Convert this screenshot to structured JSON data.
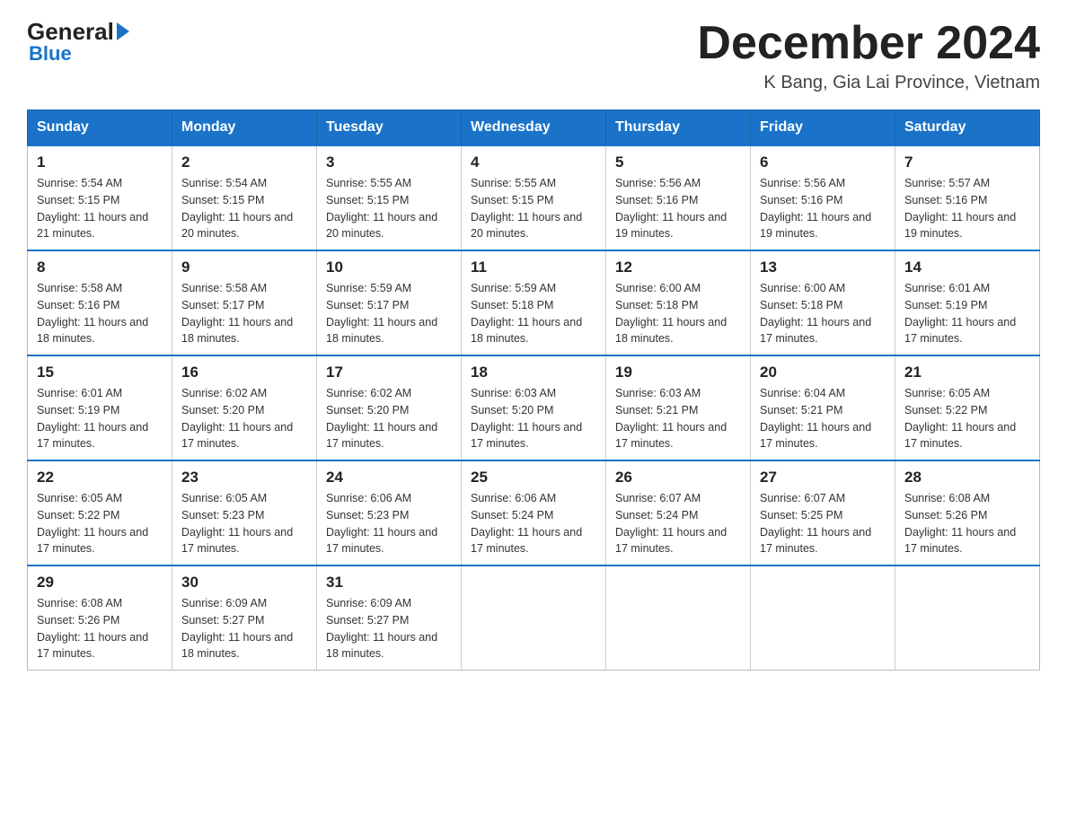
{
  "logo": {
    "text_general": "General",
    "text_blue": "Blue"
  },
  "title": "December 2024",
  "subtitle": "K Bang, Gia Lai Province, Vietnam",
  "days_of_week": [
    "Sunday",
    "Monday",
    "Tuesday",
    "Wednesday",
    "Thursday",
    "Friday",
    "Saturday"
  ],
  "weeks": [
    [
      {
        "day": "1",
        "sunrise": "5:54 AM",
        "sunset": "5:15 PM",
        "daylight": "11 hours and 21 minutes."
      },
      {
        "day": "2",
        "sunrise": "5:54 AM",
        "sunset": "5:15 PM",
        "daylight": "11 hours and 20 minutes."
      },
      {
        "day": "3",
        "sunrise": "5:55 AM",
        "sunset": "5:15 PM",
        "daylight": "11 hours and 20 minutes."
      },
      {
        "day": "4",
        "sunrise": "5:55 AM",
        "sunset": "5:15 PM",
        "daylight": "11 hours and 20 minutes."
      },
      {
        "day": "5",
        "sunrise": "5:56 AM",
        "sunset": "5:16 PM",
        "daylight": "11 hours and 19 minutes."
      },
      {
        "day": "6",
        "sunrise": "5:56 AM",
        "sunset": "5:16 PM",
        "daylight": "11 hours and 19 minutes."
      },
      {
        "day": "7",
        "sunrise": "5:57 AM",
        "sunset": "5:16 PM",
        "daylight": "11 hours and 19 minutes."
      }
    ],
    [
      {
        "day": "8",
        "sunrise": "5:58 AM",
        "sunset": "5:16 PM",
        "daylight": "11 hours and 18 minutes."
      },
      {
        "day": "9",
        "sunrise": "5:58 AM",
        "sunset": "5:17 PM",
        "daylight": "11 hours and 18 minutes."
      },
      {
        "day": "10",
        "sunrise": "5:59 AM",
        "sunset": "5:17 PM",
        "daylight": "11 hours and 18 minutes."
      },
      {
        "day": "11",
        "sunrise": "5:59 AM",
        "sunset": "5:18 PM",
        "daylight": "11 hours and 18 minutes."
      },
      {
        "day": "12",
        "sunrise": "6:00 AM",
        "sunset": "5:18 PM",
        "daylight": "11 hours and 18 minutes."
      },
      {
        "day": "13",
        "sunrise": "6:00 AM",
        "sunset": "5:18 PM",
        "daylight": "11 hours and 17 minutes."
      },
      {
        "day": "14",
        "sunrise": "6:01 AM",
        "sunset": "5:19 PM",
        "daylight": "11 hours and 17 minutes."
      }
    ],
    [
      {
        "day": "15",
        "sunrise": "6:01 AM",
        "sunset": "5:19 PM",
        "daylight": "11 hours and 17 minutes."
      },
      {
        "day": "16",
        "sunrise": "6:02 AM",
        "sunset": "5:20 PM",
        "daylight": "11 hours and 17 minutes."
      },
      {
        "day": "17",
        "sunrise": "6:02 AM",
        "sunset": "5:20 PM",
        "daylight": "11 hours and 17 minutes."
      },
      {
        "day": "18",
        "sunrise": "6:03 AM",
        "sunset": "5:20 PM",
        "daylight": "11 hours and 17 minutes."
      },
      {
        "day": "19",
        "sunrise": "6:03 AM",
        "sunset": "5:21 PM",
        "daylight": "11 hours and 17 minutes."
      },
      {
        "day": "20",
        "sunrise": "6:04 AM",
        "sunset": "5:21 PM",
        "daylight": "11 hours and 17 minutes."
      },
      {
        "day": "21",
        "sunrise": "6:05 AM",
        "sunset": "5:22 PM",
        "daylight": "11 hours and 17 minutes."
      }
    ],
    [
      {
        "day": "22",
        "sunrise": "6:05 AM",
        "sunset": "5:22 PM",
        "daylight": "11 hours and 17 minutes."
      },
      {
        "day": "23",
        "sunrise": "6:05 AM",
        "sunset": "5:23 PM",
        "daylight": "11 hours and 17 minutes."
      },
      {
        "day": "24",
        "sunrise": "6:06 AM",
        "sunset": "5:23 PM",
        "daylight": "11 hours and 17 minutes."
      },
      {
        "day": "25",
        "sunrise": "6:06 AM",
        "sunset": "5:24 PM",
        "daylight": "11 hours and 17 minutes."
      },
      {
        "day": "26",
        "sunrise": "6:07 AM",
        "sunset": "5:24 PM",
        "daylight": "11 hours and 17 minutes."
      },
      {
        "day": "27",
        "sunrise": "6:07 AM",
        "sunset": "5:25 PM",
        "daylight": "11 hours and 17 minutes."
      },
      {
        "day": "28",
        "sunrise": "6:08 AM",
        "sunset": "5:26 PM",
        "daylight": "11 hours and 17 minutes."
      }
    ],
    [
      {
        "day": "29",
        "sunrise": "6:08 AM",
        "sunset": "5:26 PM",
        "daylight": "11 hours and 17 minutes."
      },
      {
        "day": "30",
        "sunrise": "6:09 AM",
        "sunset": "5:27 PM",
        "daylight": "11 hours and 18 minutes."
      },
      {
        "day": "31",
        "sunrise": "6:09 AM",
        "sunset": "5:27 PM",
        "daylight": "11 hours and 18 minutes."
      },
      null,
      null,
      null,
      null
    ]
  ]
}
